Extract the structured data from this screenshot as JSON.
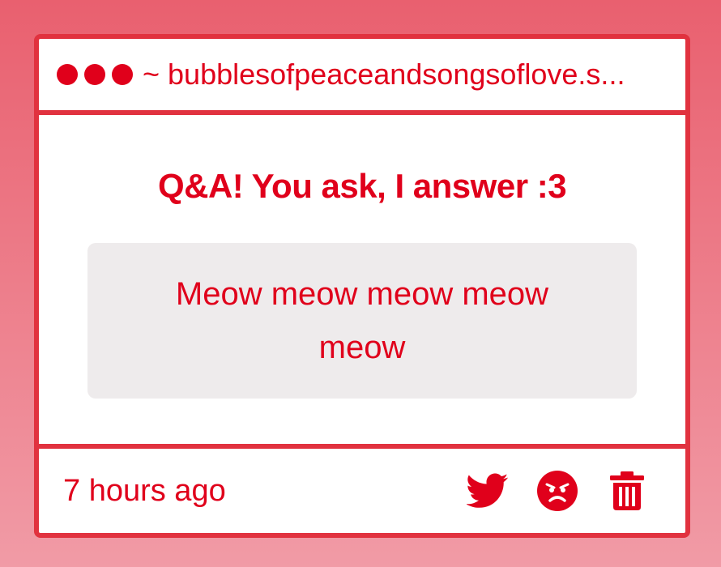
{
  "window": {
    "dots": [
      "red-dot",
      "red-dot",
      "red-dot"
    ],
    "url": "~ bubblesofpeaceandsongsoflove.s..."
  },
  "post": {
    "question": "Q&A! You ask, I answer :3",
    "answer": "Meow meow meow meow meow"
  },
  "footer": {
    "timestamp": "7 hours ago",
    "actions": [
      {
        "name": "twitter-share",
        "icon": "twitter-bird-icon"
      },
      {
        "name": "angry-react",
        "icon": "angry-face-icon"
      },
      {
        "name": "delete",
        "icon": "trash-icon"
      }
    ]
  },
  "colors": {
    "accent": "#e0001b",
    "border": "#e1323f",
    "answer_bg": "#eeebec",
    "background_top": "#e9606f",
    "background_bottom": "#f19ba6"
  }
}
